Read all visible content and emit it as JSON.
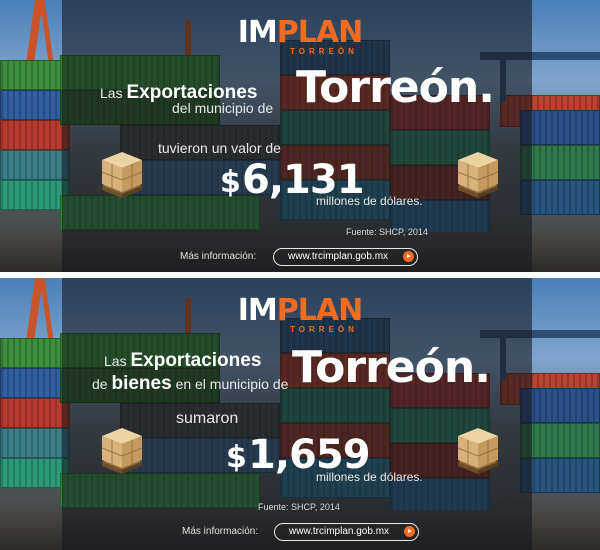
{
  "logo": {
    "part1": "IM",
    "part2": "PLAN",
    "sub": "TORREÓN"
  },
  "banners": [
    {
      "line1_pre": "Las",
      "line1_bold": "Exportaciones",
      "line2_pre": "",
      "line2_bold": "",
      "line2": "del municipio de",
      "city": "Torreón.",
      "verb": "tuvieron un valor de",
      "currency": "$",
      "amount": "6,131",
      "unit": "millones de dólares.",
      "source": "Fuente: SHCP, 2014",
      "more_label": "Más información:",
      "url": "www.trcimplan.gob.mx"
    },
    {
      "line1_pre": "Las",
      "line1_bold": "Exportaciones",
      "line2_pre": "de",
      "line2_bold": "bienes",
      "line2": "en el municipio de",
      "city": "Torreón.",
      "verb": "sumaron",
      "currency": "$",
      "amount": "1,659",
      "unit": "millones de dólares.",
      "source": "Fuente: SHCP, 2014",
      "more_label": "Más información:",
      "url": "www.trcimplan.gob.mx"
    }
  ],
  "icons": {
    "pallet": "boxes-on-pallet-icon",
    "go": "arrow-circle-icon"
  },
  "colors": {
    "brand": "#f26b22",
    "overlay": "#14161c"
  }
}
